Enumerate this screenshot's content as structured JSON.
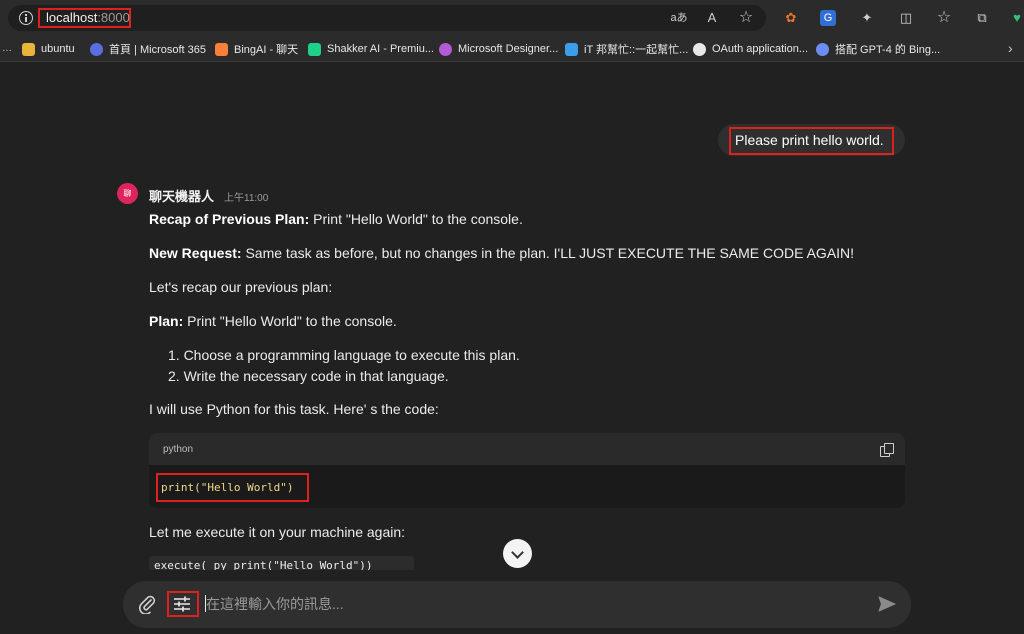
{
  "browser": {
    "url_host": "localhost",
    "url_port": ":8000",
    "toolbar_icons": [
      "read-aloud-icon",
      "immersive-reader-icon",
      "favorite-star-icon",
      "extension-icon",
      "translate-icon",
      "puzzle-icon",
      "split-screen-icon",
      "favorites-icon",
      "collections-icon",
      "performance-icon"
    ],
    "toolbar_glyphs": [
      "aあ",
      "A",
      "☆",
      "✿",
      "G",
      "✦",
      "◫",
      "☆",
      "⧉",
      "♥"
    ]
  },
  "bookmarks": [
    {
      "label": "ubuntu",
      "color": "#e8b43a"
    },
    {
      "label": "首頁 | Microsoft 365",
      "color": "#5b6ee1"
    },
    {
      "label": "BingAI - 聊天",
      "color": "#f5813a"
    },
    {
      "label": "Shakker AI - Premiu...",
      "color": "#1fd08a"
    },
    {
      "label": "Microsoft Designer...",
      "color": "#b35ad6"
    },
    {
      "label": "iT 邦幫忙::一起幫忙...",
      "color": "#3a9ee8"
    },
    {
      "label": "OAuth application...",
      "color": "#e8e8e8"
    },
    {
      "label": "搭配 GPT-4 的 Bing...",
      "color": "#6c8df2"
    }
  ],
  "conversation": {
    "user_message": "Please print hello world.",
    "bot": {
      "avatar_text": "聊",
      "name": "聊天機器人",
      "time": "上午11:00",
      "recap_label": "Recap of Previous Plan:",
      "recap_text": " Print  \"Hello World\" to the console.",
      "request_label": "New Request:",
      "request_text": " Same task as before, but no changes in the plan. I'LL JUST EXECUTE THE SAME CODE AGAIN!",
      "recap_intro": "Let's recap our previous plan:",
      "plan_label": "Plan:",
      "plan_text": " Print  \"Hello World\" to the console.",
      "steps": [
        "1. Choose a programming language to execute this plan.",
        "2. Write the necessary code in that language."
      ],
      "code_intro": "I will use Python for this task. Here' s the code:",
      "code_lang": "python",
      "code": "print(\"Hello World\")",
      "execute_intro": "Let me execute it on your machine again:",
      "execute_code_partial": "execute(  py   print(\"Hello World\"))"
    }
  },
  "composer": {
    "placeholder": "在這裡輸入你的訊息..."
  },
  "colors": {
    "highlight": "#e21f1f",
    "background": "#212121",
    "bot_avatar": "#e0245e"
  }
}
